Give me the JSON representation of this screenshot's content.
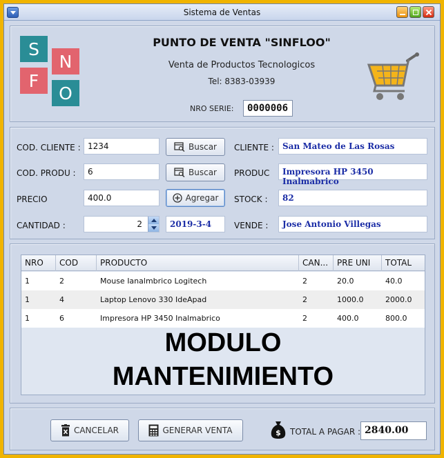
{
  "window": {
    "title": "Sistema de Ventas"
  },
  "header": {
    "logo_letters": [
      "S",
      "N",
      "F",
      "O"
    ],
    "title": "PUNTO DE VENTA \"SINFLOO\"",
    "subtitle": "Venta de Productos Tecnologicos",
    "phone": "Tel: 8383-03939",
    "serie_label": "NRO SERIE:",
    "serie_value": "0000006",
    "cart_icon": "shopping-cart-icon"
  },
  "form": {
    "cod_cliente_label": "COD. CLIENTE :",
    "cod_cliente_value": "1234",
    "cod_produ_label": "COD. PRODU :",
    "cod_produ_value": "6",
    "precio_label": "PRECIO",
    "precio_value": "400.0",
    "cantidad_label": "CANTIDAD :",
    "cantidad_value": "2",
    "fecha_value": "2019-3-4",
    "buscar_label": "Buscar",
    "agregar_label": "Agregar",
    "cliente_label": "CLIENTE :",
    "cliente_value": "San Mateo de Las Rosas",
    "produc_label": "PRODUC",
    "produc_value": "Impresora HP 3450 Inalmabrico",
    "stock_label": "STOCK :",
    "stock_value": "82",
    "vende_label": "VENDE :",
    "vende_value": "Jose Antonio Villegas"
  },
  "table": {
    "columns": [
      "NRO",
      "COD",
      "PRODUCTO",
      "CAN...",
      "PRE UNI",
      "TOTAL"
    ],
    "rows": [
      [
        "1",
        "2",
        "Mouse Ianalmbrico Logitech",
        "2",
        "20.0",
        "40.0"
      ],
      [
        "1",
        "4",
        "Laptop Lenovo 330 IdeApad",
        "2",
        "1000.0",
        "2000.0"
      ],
      [
        "1",
        "6",
        "Impresora HP 3450 Inalmabrico",
        "2",
        "400.0",
        "800.0"
      ]
    ]
  },
  "overlay": {
    "line1": "MODULO",
    "line2": "MANTENIMIENTO"
  },
  "footer": {
    "cancelar_label": "CANCELAR",
    "generar_label": "GENERAR VENTA",
    "total_label": "TOTAL A PAGAR :",
    "total_value": "2840.00"
  },
  "colors": {
    "background_frame": "#f0b400",
    "window": "#cfd8e8",
    "logo_teal": "#2a8d96",
    "logo_coral": "#e2646e",
    "blue_text": "#1b2da6"
  }
}
